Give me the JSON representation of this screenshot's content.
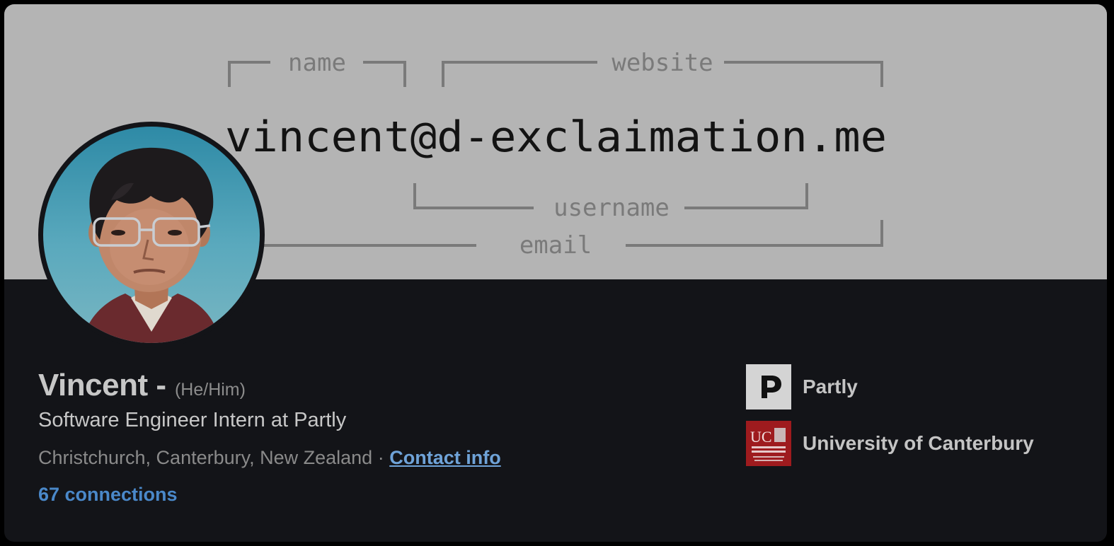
{
  "banner": {
    "email": "vincent@d-exclaimation.me",
    "label_name": "name",
    "label_website": "website",
    "label_username": "username",
    "label_email": "email"
  },
  "profile": {
    "name": "Vincent -",
    "pronouns": "(He/Him)",
    "headline": "Software Engineer Intern at Partly",
    "location": "Christchurch, Canterbury, New Zealand",
    "separator": "·",
    "contact_info": "Contact info",
    "connections": "67 connections"
  },
  "organizations": [
    {
      "label": "Partly",
      "logo": "partly-logo"
    },
    {
      "label": "University of Canterbury",
      "logo": "university-of-canterbury-logo"
    }
  ],
  "colors": {
    "banner_bg": "#b4b4b4",
    "card_bg": "#131418",
    "link": "#4a88c9",
    "uc_red": "#9e1b1e"
  }
}
